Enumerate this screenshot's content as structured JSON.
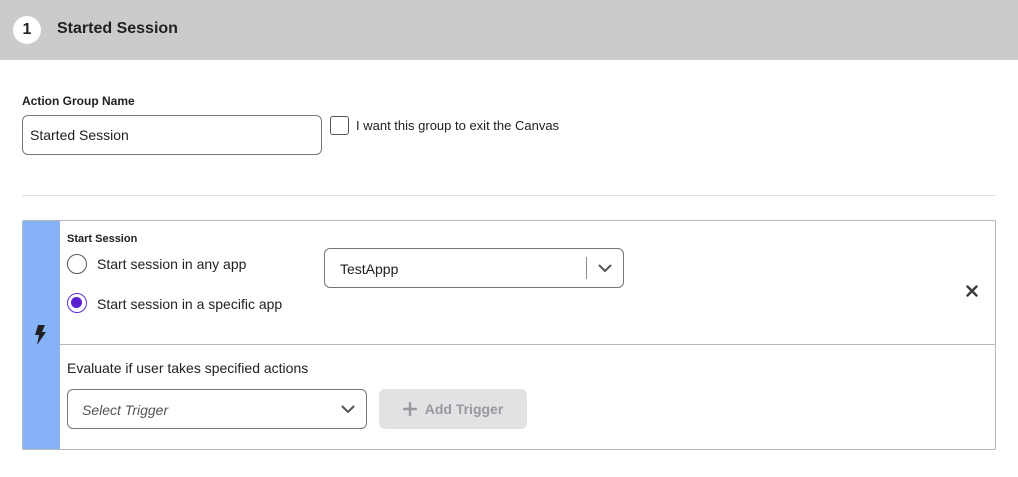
{
  "header": {
    "step_number": "1",
    "title": "Started Session"
  },
  "action_group": {
    "label": "Action Group Name",
    "name_value": "Started Session",
    "exit_checkbox_label": "I want this group to exit the Canvas",
    "exit_checked": false
  },
  "start_session": {
    "title": "Start Session",
    "options": [
      {
        "label": "Start session in any app",
        "selected": false
      },
      {
        "label": "Start session in a specific app",
        "selected": true
      }
    ],
    "app_select_value": "TestAppp"
  },
  "triggers": {
    "eval_label": "Evaluate if user takes specified actions",
    "select_placeholder": "Select Trigger",
    "add_button_label": "Add Trigger"
  },
  "icons": {
    "card_icon": "bolt-icon",
    "remove": "close-icon",
    "add": "plus-icon",
    "dropdown": "chevron-down-icon"
  },
  "colors": {
    "header_bg": "#cbcbcd",
    "stripe": "#86b3f7",
    "radio_selected": "#5a1fd1",
    "disabled_button_bg": "#e2e2e4"
  }
}
